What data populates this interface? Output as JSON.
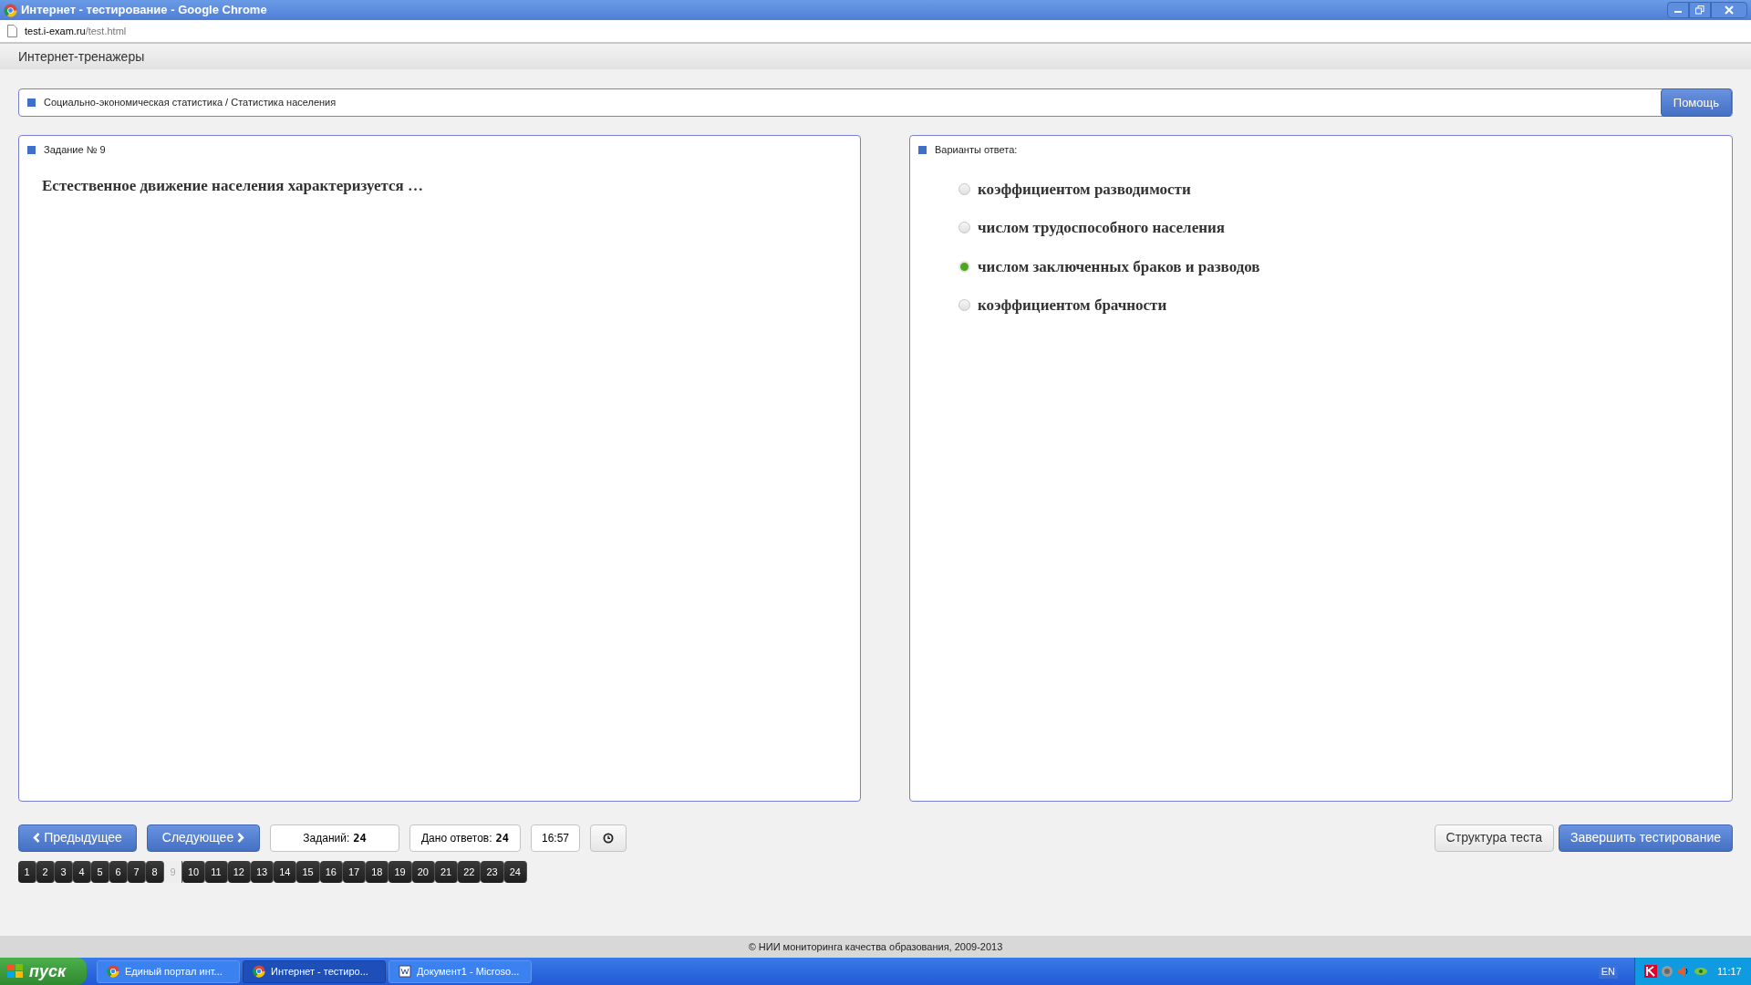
{
  "window": {
    "title": "Интернет - тестирование - Google Chrome"
  },
  "address_bar": {
    "host": "test.i-exam.ru",
    "path": "/test.html"
  },
  "header": {
    "title": "Интернет-тренажеры"
  },
  "breadcrumb": {
    "text": "Социально-экономическая статистика / Статистика населения",
    "help_button": "Помощь"
  },
  "question_panel": {
    "title": "Задание № 9",
    "question": "Естественное движение населения характеризуется …"
  },
  "answers_panel": {
    "title": "Варианты ответа:",
    "options": [
      {
        "label": "коэффициентом разводимости",
        "selected": false
      },
      {
        "label": "числом трудоспособного населения",
        "selected": false
      },
      {
        "label": "числом заключенных браков и разводов",
        "selected": true
      },
      {
        "label": "коэффициентом брачности",
        "selected": false
      }
    ]
  },
  "toolbar": {
    "prev_button": "Предыдущее",
    "next_button": "Следующее",
    "tasks_label": "Заданий:",
    "tasks_count": "24",
    "answered_label": "Дано ответов:",
    "answered_count": "24",
    "timer": "16:57",
    "structure_button": "Структура теста",
    "finish_button": "Завершить тестирование"
  },
  "pages": [
    {
      "label": "1",
      "selected": false
    },
    {
      "label": "2",
      "selected": false
    },
    {
      "label": "3",
      "selected": false
    },
    {
      "label": "4",
      "selected": false
    },
    {
      "label": "5",
      "selected": false
    },
    {
      "label": "6",
      "selected": false
    },
    {
      "label": "7",
      "selected": false
    },
    {
      "label": "8",
      "selected": false
    },
    {
      "label": "9",
      "selected": true
    },
    {
      "label": "10",
      "selected": false
    },
    {
      "label": "11",
      "selected": false
    },
    {
      "label": "12",
      "selected": false
    },
    {
      "label": "13",
      "selected": false
    },
    {
      "label": "14",
      "selected": false
    },
    {
      "label": "15",
      "selected": false
    },
    {
      "label": "16",
      "selected": false
    },
    {
      "label": "17",
      "selected": false
    },
    {
      "label": "18",
      "selected": false
    },
    {
      "label": "19",
      "selected": false
    },
    {
      "label": "20",
      "selected": false
    },
    {
      "label": "21",
      "selected": false
    },
    {
      "label": "22",
      "selected": false
    },
    {
      "label": "23",
      "selected": false
    },
    {
      "label": "24",
      "selected": false
    }
  ],
  "footer": {
    "text": "© НИИ мониторинга качества образования, 2009-2013"
  },
  "taskbar": {
    "start": "пуск",
    "tasks": [
      {
        "label": "Единый портал инт...",
        "kind": "chrome",
        "selected": false
      },
      {
        "label": "Интернет - тестиро...",
        "kind": "chrome",
        "selected": true
      },
      {
        "label": "Документ1 - Microso...",
        "kind": "word",
        "selected": false
      }
    ],
    "language": "EN",
    "clock": "11:17"
  }
}
